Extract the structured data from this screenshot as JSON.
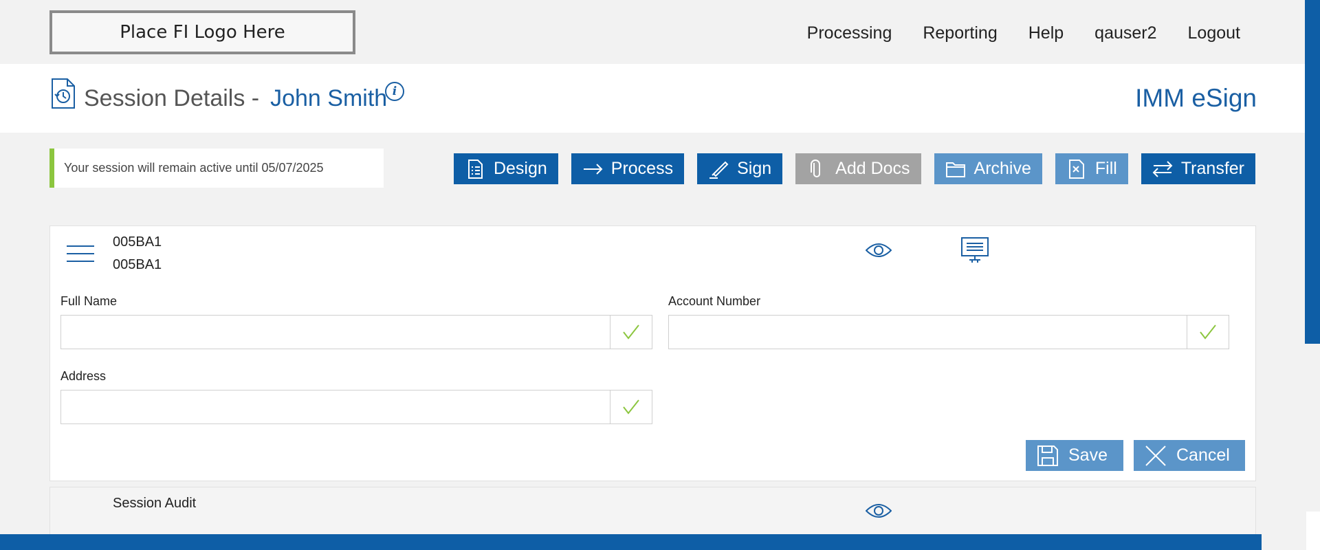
{
  "logo": {
    "text": "Place FI Logo Here"
  },
  "nav": [
    "Processing",
    "Reporting",
    "Help",
    "qauser2",
    "Logout"
  ],
  "header": {
    "title_prefix": "Session Details -",
    "customer_name": "John Smith",
    "info_icon": "i",
    "brand": "IMM eSign"
  },
  "notice": {
    "text": "Your session will remain active until 05/07/2025"
  },
  "toolbar": [
    {
      "label": "Design",
      "icon": "checklist-icon",
      "state": "primary"
    },
    {
      "label": "Process",
      "icon": "arrow-right-icon",
      "state": "primary"
    },
    {
      "label": "Sign",
      "icon": "pen-icon",
      "state": "primary"
    },
    {
      "label": "Add Docs",
      "icon": "paperclip-icon",
      "state": "disabled"
    },
    {
      "label": "Archive",
      "icon": "folder-icon",
      "state": "light"
    },
    {
      "label": "Fill",
      "icon": "document-x-icon",
      "state": "light"
    },
    {
      "label": "Transfer",
      "icon": "transfer-icon",
      "state": "primary"
    }
  ],
  "document": {
    "code_line1": "005BA1",
    "code_line2": "005BA1",
    "fields": [
      {
        "label": "Full Name",
        "value": ""
      },
      {
        "label": "Account Number",
        "value": ""
      },
      {
        "label": "Address",
        "value": ""
      }
    ],
    "save_label": "Save",
    "cancel_label": "Cancel"
  },
  "audit": {
    "title": "Session Audit"
  },
  "colors": {
    "primary": "#0e5ea6",
    "light": "#5b95c9",
    "disabled": "#a3a3a3",
    "success": "#8cc63f"
  }
}
